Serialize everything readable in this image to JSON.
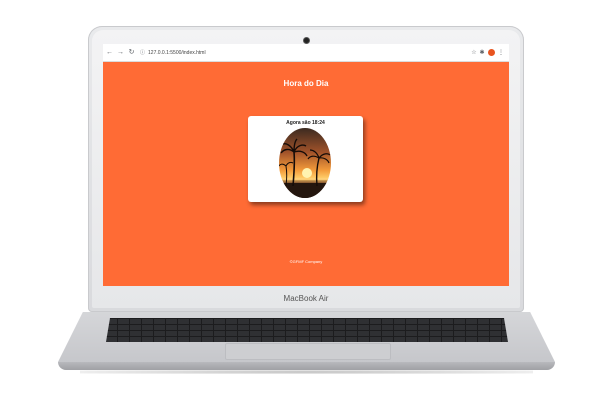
{
  "browser": {
    "nav": {
      "back_icon": "back-arrow-icon",
      "forward_icon": "forward-arrow-icon",
      "reload_icon": "reload-icon"
    },
    "url": "127.0.0.1:5500/index.html",
    "right_icons": [
      "star-icon",
      "extensions-icon",
      "profile-avatar",
      "menu-icon"
    ]
  },
  "page": {
    "title": "Hora do Dia",
    "background_color": "#ff6b35",
    "card": {
      "time_text": "Agora são 18:24",
      "image_alt": "sunset-image"
    },
    "footer": "©GFMF Company"
  },
  "laptop": {
    "model_label": "MacBook Air"
  }
}
